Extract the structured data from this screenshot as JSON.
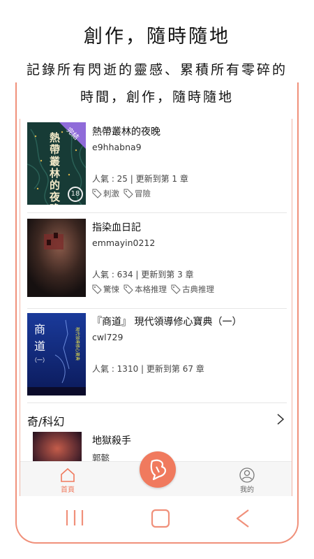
{
  "headline": {
    "title": "創作，隨時隨地",
    "line1": "記錄所有閃逝的靈感、累積所有零碎的",
    "line2": "時間，創作，隨時隨地"
  },
  "books": [
    {
      "title": "熱帶叢林的夜晚",
      "author": "e9hhabna9",
      "stats": "人氣 : 25  |  更新到第 1 章",
      "tags": [
        "刺激",
        "冒險"
      ],
      "cover_text": "熱帶叢林的夜晚",
      "cover_badge": "完結",
      "cover_age": "18"
    },
    {
      "title": "指染血日記",
      "author": "emmayin0212",
      "stats": "人氣 : 634  |  更新到第 3 章",
      "tags": [
        "驚悚",
        "本格推理",
        "古典推理"
      ]
    },
    {
      "title": "『商道』 現代領導修心寶典（一）",
      "author": "cwl729",
      "stats": "人氣 : 1310  |  更新到第 67 章",
      "tags": [],
      "cover_text": "商道",
      "cover_sub": "（一）"
    }
  ],
  "section": {
    "title": "奇/科幻",
    "first_book": {
      "title": "地獄殺手",
      "author": "郭懿"
    }
  },
  "tabs": {
    "home": "首頁",
    "mine": "我的"
  },
  "colors": {
    "accent": "#f07a5e",
    "frame": "#f0907a"
  }
}
